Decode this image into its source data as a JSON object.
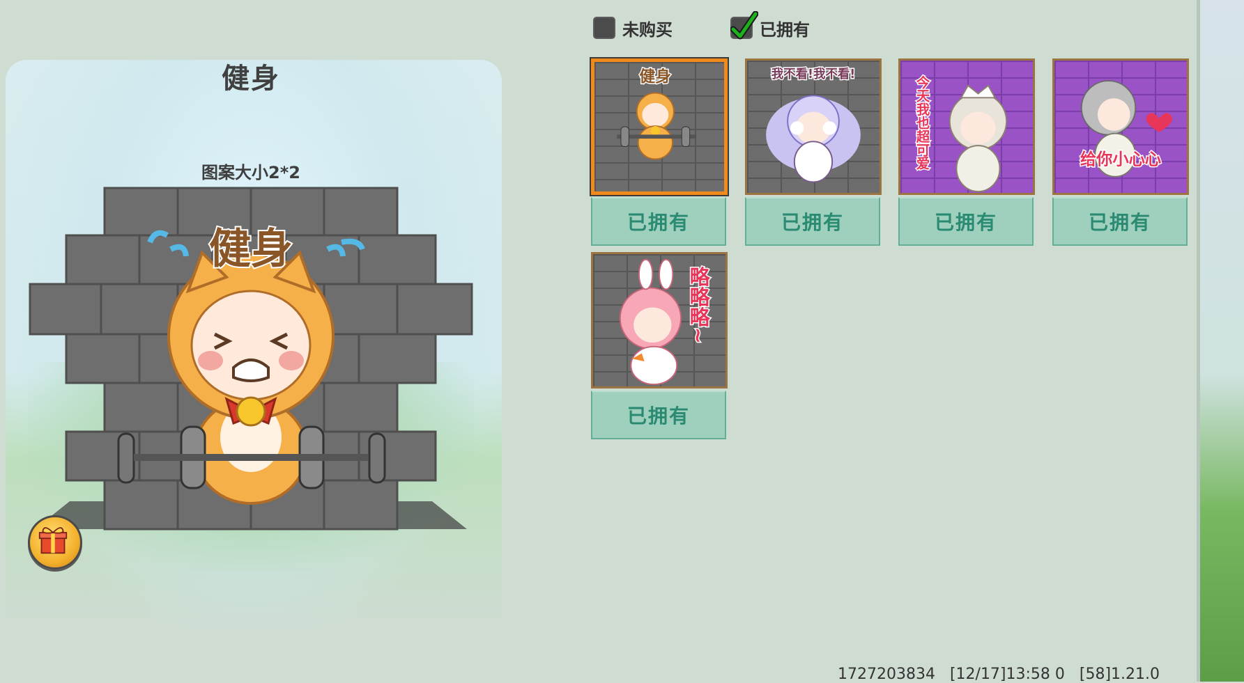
{
  "preview": {
    "title": "健身",
    "size_label": "图案大小2*2",
    "artwork_text": "健身",
    "gift_icon": "gift-icon"
  },
  "filters": [
    {
      "label": "未购买",
      "checked": false
    },
    {
      "label": "已拥有",
      "checked": true
    }
  ],
  "items": [
    {
      "caption": "健身",
      "button": "已拥有",
      "bg": "gray",
      "selected": true
    },
    {
      "caption": "我不看!我不看!",
      "button": "已拥有",
      "bg": "gray",
      "selected": false
    },
    {
      "caption": "今天我也超可爱",
      "button": "已拥有",
      "bg": "purple",
      "selected": false
    },
    {
      "caption": "给你小心心",
      "button": "已拥有",
      "bg": "purple",
      "selected": false
    },
    {
      "caption": "略略略~",
      "button": "已拥有",
      "bg": "gray",
      "selected": false
    }
  ],
  "status": {
    "text": "1727203834   [12/17]13:58 0   [58]1.21.0"
  },
  "colors": {
    "accent_border": "#f08a1c",
    "own_button_bg": "#9fd0bd",
    "own_button_text": "#2a8a72",
    "check_green": "#1db21d"
  }
}
